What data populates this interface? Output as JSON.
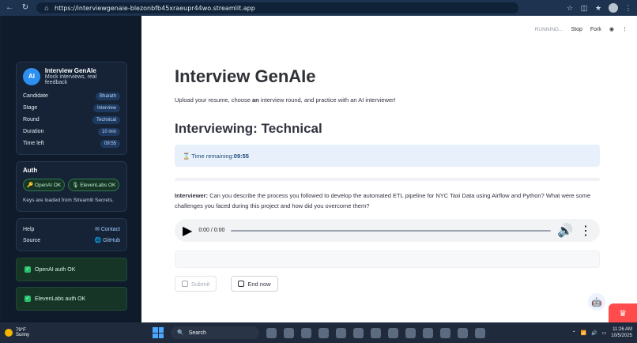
{
  "browser": {
    "url": "https://interviewgenaie-blezonbfb45xraeupr44wo.streamlit.app"
  },
  "sidebar": {
    "brand_initials": "AI",
    "brand_title": "Interview GenAIe",
    "brand_subtitle": "Mock interviews, real feedback",
    "details": [
      {
        "label": "Candidate",
        "value": "Bharath"
      },
      {
        "label": "Stage",
        "value": "Interview"
      },
      {
        "label": "Round",
        "value": "Technical"
      },
      {
        "label": "Duration",
        "value": "10 min"
      },
      {
        "label": "Time left",
        "value": "09:55"
      }
    ],
    "auth_title": "Auth",
    "auth_pills": [
      "🔑 OpenAI OK",
      "🎙 ElevenLabs OK"
    ],
    "auth_note": "Keys are loaded from Streamlit Secrets.",
    "links": [
      {
        "label": "Help",
        "link": "✉ Contact"
      },
      {
        "label": "Source",
        "link": "🌐 GitHub"
      }
    ],
    "status": [
      "OpenAI auth OK",
      "ElevenLabs auth OK"
    ]
  },
  "topbar": {
    "running": "RUNNING...",
    "stop": "Stop",
    "fork": "Fork"
  },
  "main": {
    "title": "Interview GenAIe",
    "subtitle_before": "Upload your resume, choose ",
    "subtitle_bold": "an",
    "subtitle_after": " interview round, and practice with an AI interviewer!",
    "section_title": "Interviewing: Technical",
    "timer_label": "⌛ Time remaining: ",
    "timer_value": "09:55",
    "interviewer_label": "Interviewer:",
    "question": " Can you describe the process you followed to develop the automated ETL pipeline for NYC Taxi Data using Airflow and Python? What were some challenges you faced during this project and how did you overcome them?",
    "audio_time": "0:00 / 0:00",
    "submit_label": "Submit",
    "end_label": "End now"
  },
  "taskbar": {
    "temp": "79°F",
    "weather": "Sunny",
    "search": "Search",
    "time": "11:26 AM",
    "date": "10/5/2025"
  }
}
